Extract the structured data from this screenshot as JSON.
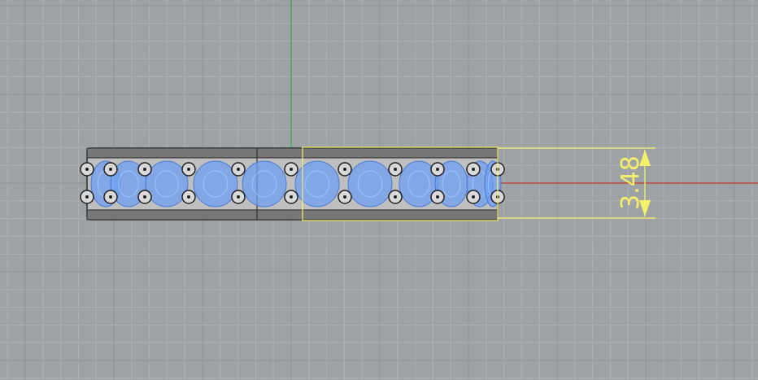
{
  "viewport": {
    "dimension_value": "3.48",
    "grid_color": "#aeb1b4",
    "grid_major_color": "#8f9295",
    "axis_x_color": "#c0392b",
    "axis_y_color": "#2fa84f",
    "background_color": "#9fa2a5",
    "dimension_color": "#f5f06a",
    "gem_color": "#6f9ff0",
    "metal_color": "#3a3a3a"
  }
}
